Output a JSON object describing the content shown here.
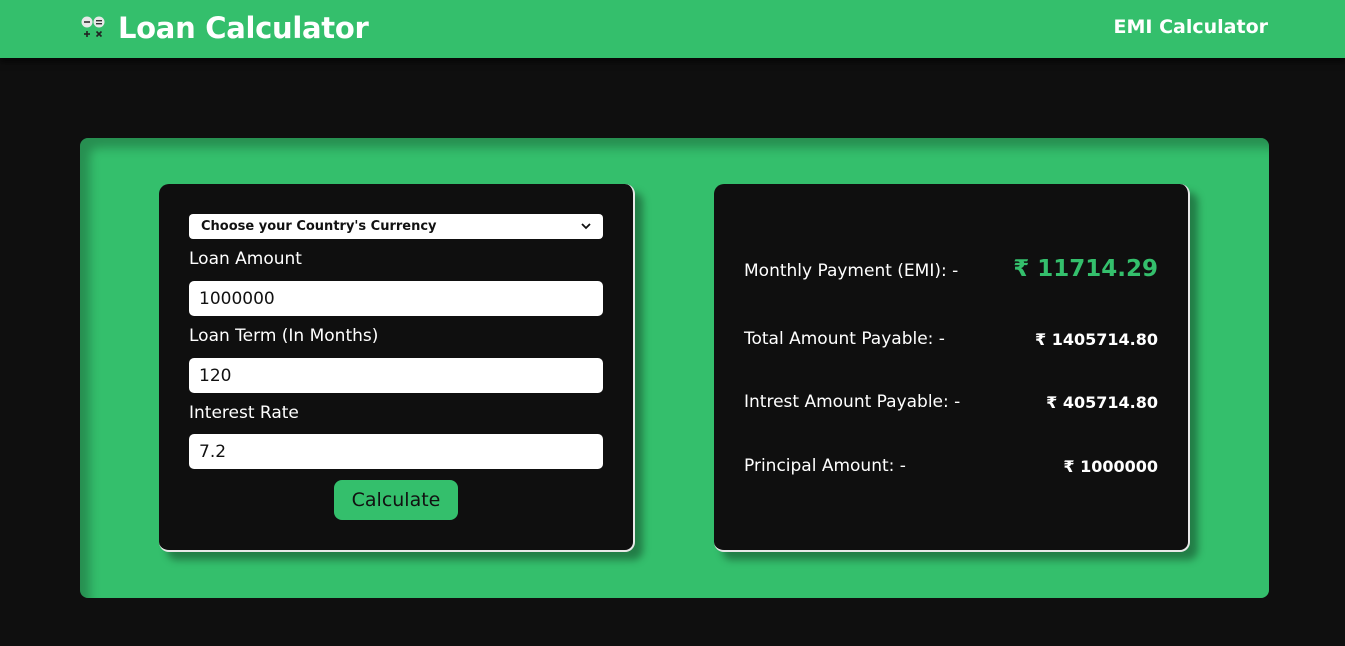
{
  "header": {
    "title": "Loan Calculator",
    "nav_link": "EMI Calculator",
    "logo_icon": "calculator-icon"
  },
  "form": {
    "currency_select": "Choose your Country's Currency",
    "loan_amount_label": "Loan Amount",
    "loan_amount_value": "1000000",
    "loan_term_label": "Loan Term (In Months)",
    "loan_term_value": "120",
    "interest_rate_label": "Interest Rate",
    "interest_rate_value": "7.2",
    "calculate_label": "Calculate"
  },
  "results": {
    "emi_label": "Monthly Payment (EMI): -",
    "emi_value": "₹ 11714.29",
    "total_label": "Total Amount Payable: -",
    "total_value": "₹ 1405714.80",
    "interest_label": "Intrest Amount Payable: -",
    "interest_value": "₹ 405714.80",
    "principal_label": "Principal Amount: -",
    "principal_value": "₹ 1000000"
  },
  "colors": {
    "accent": "#34bf6c",
    "background": "#0f0f0f",
    "card": "#0f0f0f"
  }
}
